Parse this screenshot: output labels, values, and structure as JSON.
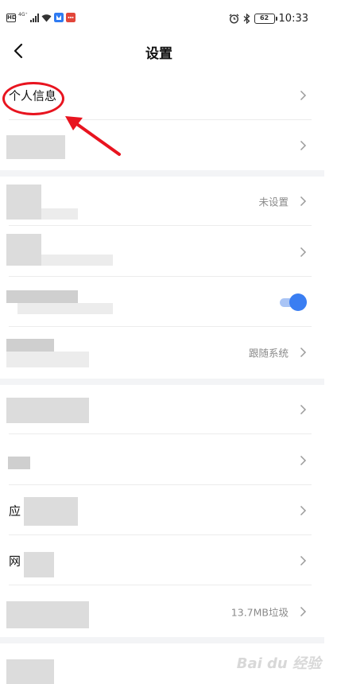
{
  "status_bar": {
    "hd_label": "HD",
    "network_label": "4G⁺",
    "battery": "62",
    "time": "10:33"
  },
  "nav": {
    "title": "设置"
  },
  "rows": [
    {
      "label": "个人信息",
      "value": ""
    },
    {
      "label": "",
      "value": ""
    },
    {
      "label": "",
      "value": "未设置"
    },
    {
      "label": "",
      "value": ""
    },
    {
      "label": "",
      "value": "",
      "toggle_on": true
    },
    {
      "label": "",
      "value": "跟随系统"
    },
    {
      "label": "",
      "value": ""
    },
    {
      "label": "",
      "value": ""
    },
    {
      "label": "应",
      "value": ""
    },
    {
      "label": "网",
      "value": ""
    },
    {
      "label": "",
      "value": "13.7MB垃圾"
    },
    {
      "label": "",
      "value": ""
    }
  ],
  "annotation": {
    "highlight_color": "#e8141f"
  },
  "accent_color": "#3a7ef2",
  "watermark": "Bai du 经验"
}
